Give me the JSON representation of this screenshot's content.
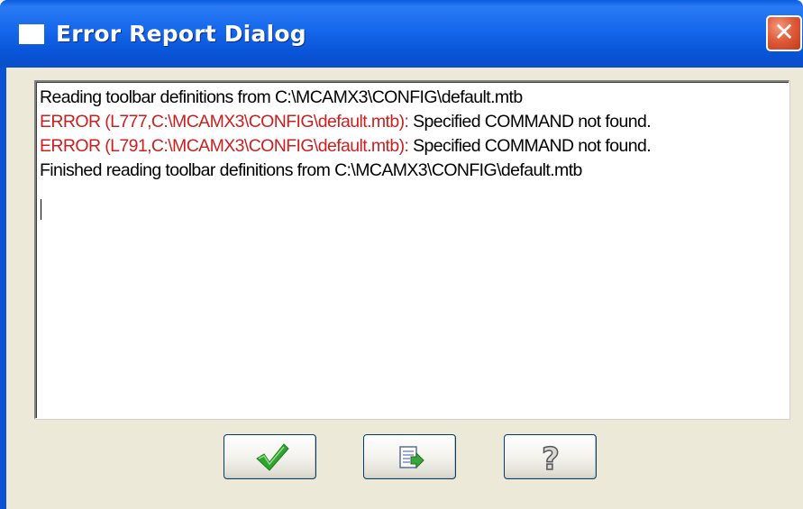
{
  "window": {
    "title": "Error Report Dialog",
    "close_label": "✕"
  },
  "log": {
    "lines": [
      {
        "prefix": "",
        "text": "Reading toolbar definitions from C:\\MCAMX3\\CONFIG\\default.mtb"
      },
      {
        "prefix": "ERROR (L777,C:\\MCAMX3\\CONFIG\\default.mtb):",
        "text": " Specified COMMAND not found."
      },
      {
        "prefix": "ERROR (L791,C:\\MCAMX3\\CONFIG\\default.mtb):",
        "text": " Specified COMMAND not found."
      },
      {
        "prefix": "",
        "text": "Finished reading toolbar definitions from C:\\MCAMX3\\CONFIG\\default.mtb"
      }
    ],
    "error_color": "#cc1f1f"
  },
  "buttons": {
    "ok_icon": "checkmark-icon",
    "export_icon": "export-document-icon",
    "help_icon": "question-mark-icon",
    "help_glyph": "?"
  }
}
